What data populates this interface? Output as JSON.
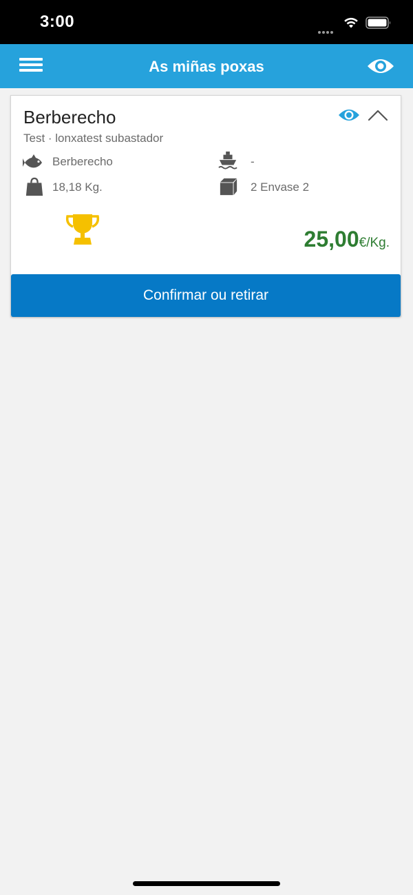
{
  "status_bar": {
    "time": "3:00"
  },
  "header": {
    "title": "As miñas poxas",
    "menu_icon": "hamburger-menu-icon",
    "eye_icon": "eye-icon"
  },
  "card": {
    "title": "Berberecho",
    "subtitle": "Test · lonxatest subastador",
    "species": "Berberecho",
    "vessel": "-",
    "weight": "18,18 Kg.",
    "packaging": "2 Envase 2",
    "price_value": "25,00",
    "price_unit": "€/Kg.",
    "confirm_label": "Confirmar ou retirar"
  },
  "colors": {
    "header_bg": "#26a2dc",
    "button_bg": "#0679c6",
    "price": "#2e7d32",
    "trophy": "#f5c000",
    "icon_grey": "#555555",
    "background": "#f2f2f2"
  }
}
